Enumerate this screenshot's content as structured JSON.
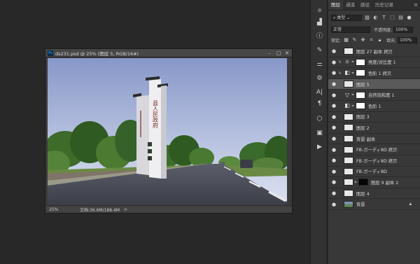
{
  "document": {
    "title": "ds231.psd @ 25% (图层 5, RGB/16#)",
    "zoom": "25%",
    "doc_size": "文档:36.6M/188.4M",
    "status_arrow": ">"
  },
  "window_controls": {
    "minimize": "–",
    "maximize": "□",
    "close": "✕"
  },
  "panel_tabs": [
    "图层",
    "通道",
    "路径",
    "历史记录"
  ],
  "panel_menu": "≡",
  "filter": {
    "label": "类型"
  },
  "blend_mode": "正常",
  "opacity": {
    "label": "不透明度:",
    "value": "100%"
  },
  "lock": {
    "label": "锁定:"
  },
  "fill": {
    "label": "填充:",
    "value": "100%"
  },
  "layers": [
    {
      "name": "图层 27 副本 拷贝",
      "kind": "pixel"
    },
    {
      "name": "亮度/对比度 1",
      "kind": "adjustment",
      "icon": "☼",
      "clipped": true
    },
    {
      "name": "色阶 1 拷贝",
      "kind": "adjustment",
      "icon": "◧",
      "clipped": true
    },
    {
      "name": "图层 5",
      "kind": "pixel",
      "selected": true
    },
    {
      "name": "自然饱和度 1",
      "kind": "adjustment",
      "icon": "▽"
    },
    {
      "name": "色阶 1",
      "kind": "adjustment",
      "icon": "◧"
    },
    {
      "name": "图层 3",
      "kind": "pixel"
    },
    {
      "name": "图层 2",
      "kind": "pixel"
    },
    {
      "name": "背景 副本",
      "kind": "pixel"
    },
    {
      "name": "FB-ガーディ8D 拷贝",
      "kind": "pixel"
    },
    {
      "name": "FB-ガーディ8D 拷贝",
      "kind": "pixel"
    },
    {
      "name": "FB-ガーディ8D",
      "kind": "pixel"
    },
    {
      "name": "图层 9 副本 2",
      "kind": "pixel",
      "dark_mask": true
    },
    {
      "name": "图层 4",
      "kind": "pixel"
    },
    {
      "name": "背景",
      "kind": "background",
      "locked": true
    }
  ],
  "sign_text": "县人民政府",
  "colors": {
    "accent_selected": "#5a5a5a",
    "sky_top": "#8a9ccc",
    "sky_bottom": "#cfd6ea",
    "road": "#43464f"
  }
}
